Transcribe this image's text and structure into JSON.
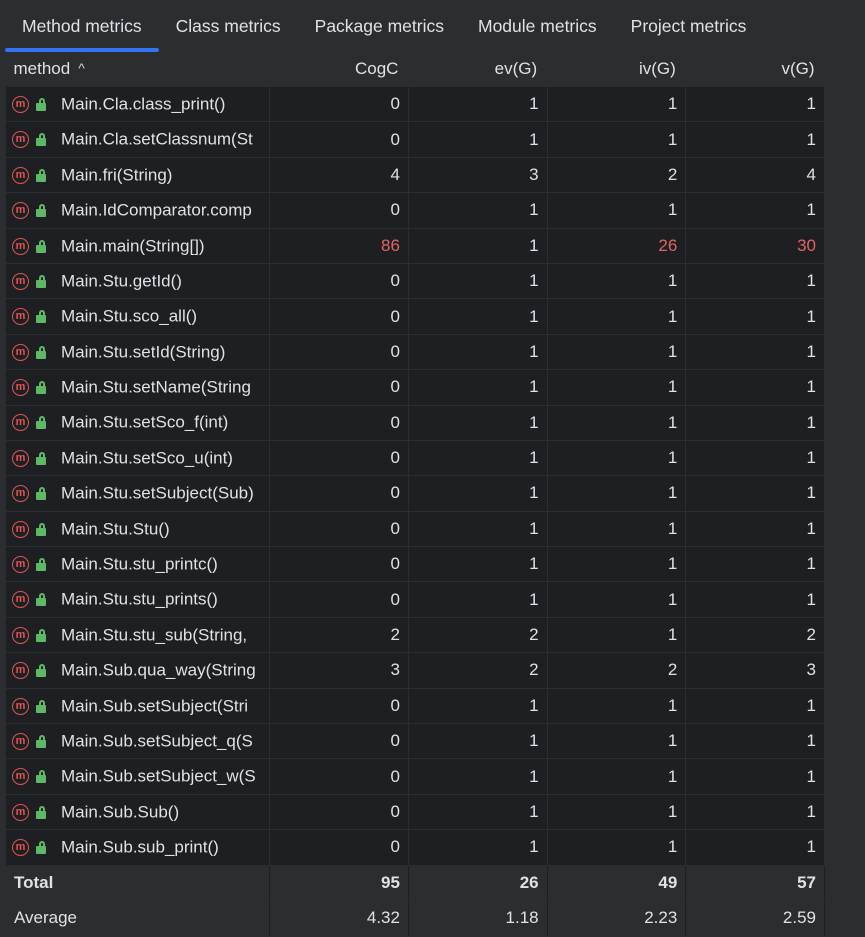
{
  "tabs": [
    {
      "label": "Method metrics",
      "active": true
    },
    {
      "label": "Class metrics",
      "active": false
    },
    {
      "label": "Package metrics",
      "active": false
    },
    {
      "label": "Module metrics",
      "active": false
    },
    {
      "label": "Project metrics",
      "active": false
    }
  ],
  "columns": [
    "method",
    "CogC",
    "ev(G)",
    "iv(G)",
    "v(G)"
  ],
  "sort_indicator": "^",
  "icon_letter": "m",
  "warn_color": "#e06464",
  "rows": [
    {
      "method": "Main.Cla.class_print()",
      "cogc": "0",
      "evg": "1",
      "ivg": "1",
      "vg": "1",
      "warn": []
    },
    {
      "method": "Main.Cla.setClassnum(St",
      "cogc": "0",
      "evg": "1",
      "ivg": "1",
      "vg": "1",
      "warn": []
    },
    {
      "method": "Main.fri(String)",
      "cogc": "4",
      "evg": "3",
      "ivg": "2",
      "vg": "4",
      "warn": []
    },
    {
      "method": "Main.IdComparator.comp",
      "cogc": "0",
      "evg": "1",
      "ivg": "1",
      "vg": "1",
      "warn": []
    },
    {
      "method": "Main.main(String[])",
      "cogc": "86",
      "evg": "1",
      "ivg": "26",
      "vg": "30",
      "warn": [
        "cogc",
        "ivg",
        "vg"
      ]
    },
    {
      "method": "Main.Stu.getId()",
      "cogc": "0",
      "evg": "1",
      "ivg": "1",
      "vg": "1",
      "warn": []
    },
    {
      "method": "Main.Stu.sco_all()",
      "cogc": "0",
      "evg": "1",
      "ivg": "1",
      "vg": "1",
      "warn": []
    },
    {
      "method": "Main.Stu.setId(String)",
      "cogc": "0",
      "evg": "1",
      "ivg": "1",
      "vg": "1",
      "warn": []
    },
    {
      "method": "Main.Stu.setName(String",
      "cogc": "0",
      "evg": "1",
      "ivg": "1",
      "vg": "1",
      "warn": []
    },
    {
      "method": "Main.Stu.setSco_f(int)",
      "cogc": "0",
      "evg": "1",
      "ivg": "1",
      "vg": "1",
      "warn": []
    },
    {
      "method": "Main.Stu.setSco_u(int)",
      "cogc": "0",
      "evg": "1",
      "ivg": "1",
      "vg": "1",
      "warn": []
    },
    {
      "method": "Main.Stu.setSubject(Sub)",
      "cogc": "0",
      "evg": "1",
      "ivg": "1",
      "vg": "1",
      "warn": []
    },
    {
      "method": "Main.Stu.Stu()",
      "cogc": "0",
      "evg": "1",
      "ivg": "1",
      "vg": "1",
      "warn": []
    },
    {
      "method": "Main.Stu.stu_printc()",
      "cogc": "0",
      "evg": "1",
      "ivg": "1",
      "vg": "1",
      "warn": []
    },
    {
      "method": "Main.Stu.stu_prints()",
      "cogc": "0",
      "evg": "1",
      "ivg": "1",
      "vg": "1",
      "warn": []
    },
    {
      "method": "Main.Stu.stu_sub(String,",
      "cogc": "2",
      "evg": "2",
      "ivg": "1",
      "vg": "2",
      "warn": []
    },
    {
      "method": "Main.Sub.qua_way(String",
      "cogc": "3",
      "evg": "2",
      "ivg": "2",
      "vg": "3",
      "warn": []
    },
    {
      "method": "Main.Sub.setSubject(Stri",
      "cogc": "0",
      "evg": "1",
      "ivg": "1",
      "vg": "1",
      "warn": []
    },
    {
      "method": "Main.Sub.setSubject_q(S",
      "cogc": "0",
      "evg": "1",
      "ivg": "1",
      "vg": "1",
      "warn": []
    },
    {
      "method": "Main.Sub.setSubject_w(S",
      "cogc": "0",
      "evg": "1",
      "ivg": "1",
      "vg": "1",
      "warn": []
    },
    {
      "method": "Main.Sub.Sub()",
      "cogc": "0",
      "evg": "1",
      "ivg": "1",
      "vg": "1",
      "warn": []
    },
    {
      "method": "Main.Sub.sub_print()",
      "cogc": "0",
      "evg": "1",
      "ivg": "1",
      "vg": "1",
      "warn": []
    }
  ],
  "total": {
    "label": "Total",
    "cogc": "95",
    "evg": "26",
    "ivg": "49",
    "vg": "57"
  },
  "average": {
    "label": "Average",
    "cogc": "4.32",
    "evg": "1.18",
    "ivg": "2.23",
    "vg": "2.59"
  }
}
